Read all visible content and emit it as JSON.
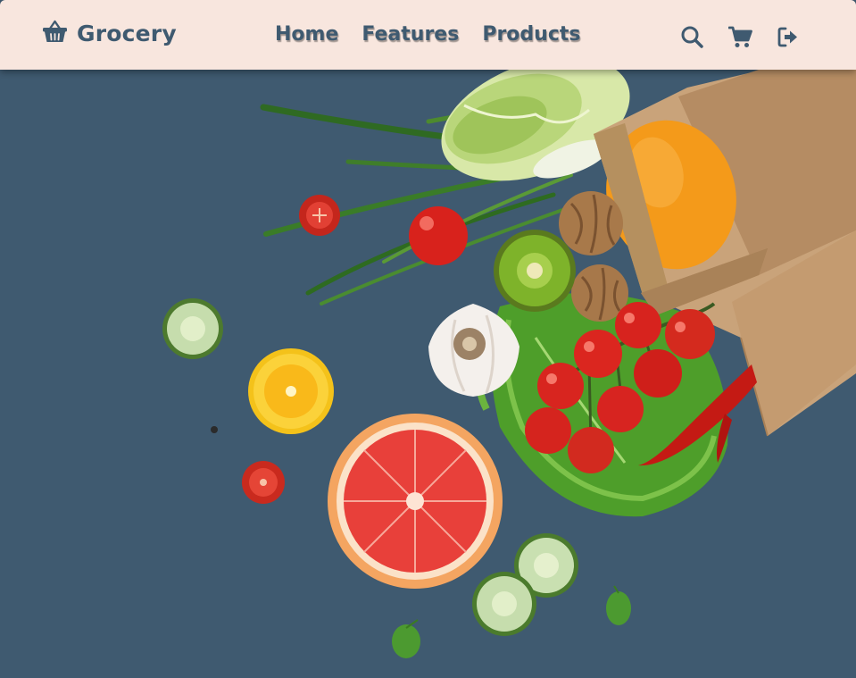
{
  "header": {
    "logo": {
      "text": "Grocery",
      "icon": "basket-icon"
    },
    "nav": [
      {
        "label": "Home"
      },
      {
        "label": "Features"
      },
      {
        "label": "Products"
      }
    ],
    "actions": [
      {
        "icon": "search-icon"
      },
      {
        "icon": "cart-icon"
      },
      {
        "icon": "logout-icon"
      }
    ]
  },
  "hero": {
    "image": "grocery-bag-vegetables-illustration",
    "background_color": "#3f5a70"
  },
  "colors": {
    "header_bg": "#f8e6de",
    "brand": "#3f5a70"
  }
}
